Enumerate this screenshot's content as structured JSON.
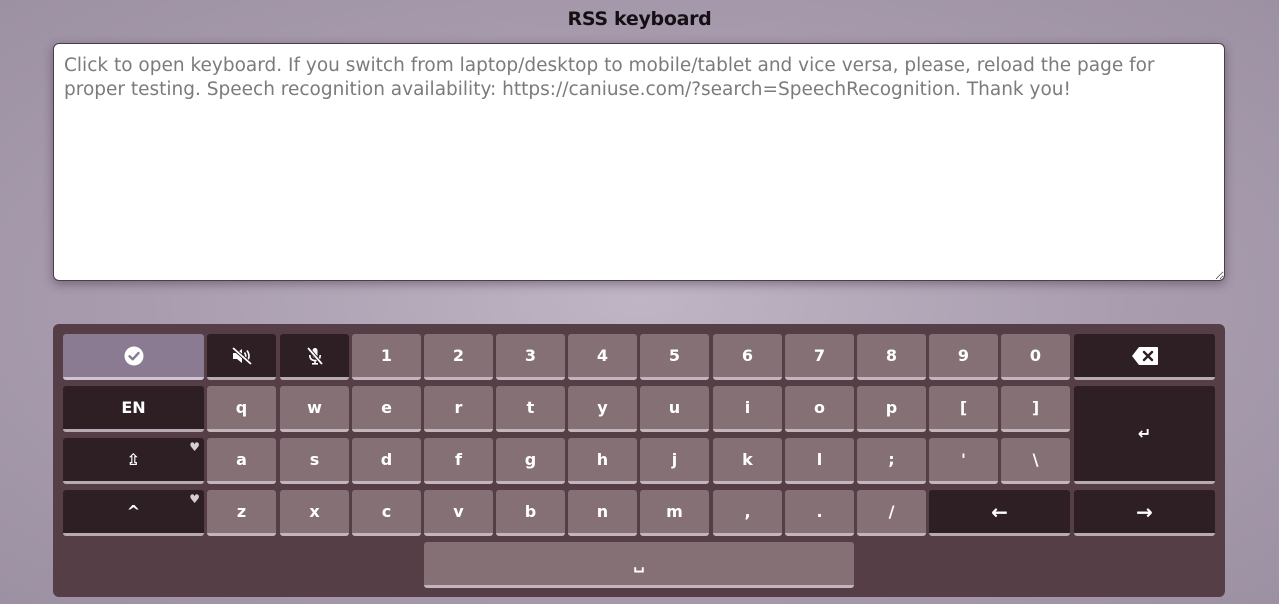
{
  "page": {
    "title": "RSS keyboard"
  },
  "textarea": {
    "placeholder": "Click to open keyboard. If you switch from laptop/desktop to mobile/tablet and vice versa, please, reload the page for proper testing. Speech recognition availability: https://caniuse.com/?search=SpeechRecognition. Thank you!"
  },
  "keyboard": {
    "row1": [
      "1",
      "2",
      "3",
      "4",
      "5",
      "6",
      "7",
      "8",
      "9",
      "0"
    ],
    "row2": [
      "q",
      "w",
      "e",
      "r",
      "t",
      "y",
      "u",
      "i",
      "o",
      "p",
      "[",
      "]"
    ],
    "row3": [
      "a",
      "s",
      "d",
      "f",
      "g",
      "h",
      "j",
      "k",
      "l",
      ";",
      "'",
      "\\"
    ],
    "row4": [
      "z",
      "x",
      "c",
      "v",
      "b",
      "n",
      "m",
      ",",
      ".",
      "/"
    ],
    "lang_label": "EN",
    "caps_label": "⇫",
    "shift_label": "^",
    "heart": "♥",
    "enter_label": "↵",
    "left_label": "←",
    "right_label": "→",
    "space_label": "␣",
    "icons": {
      "done": "check-circle-icon",
      "sound": "volume-mute-icon",
      "mic": "microphone-slash-icon",
      "backspace": "backspace-icon"
    }
  }
}
